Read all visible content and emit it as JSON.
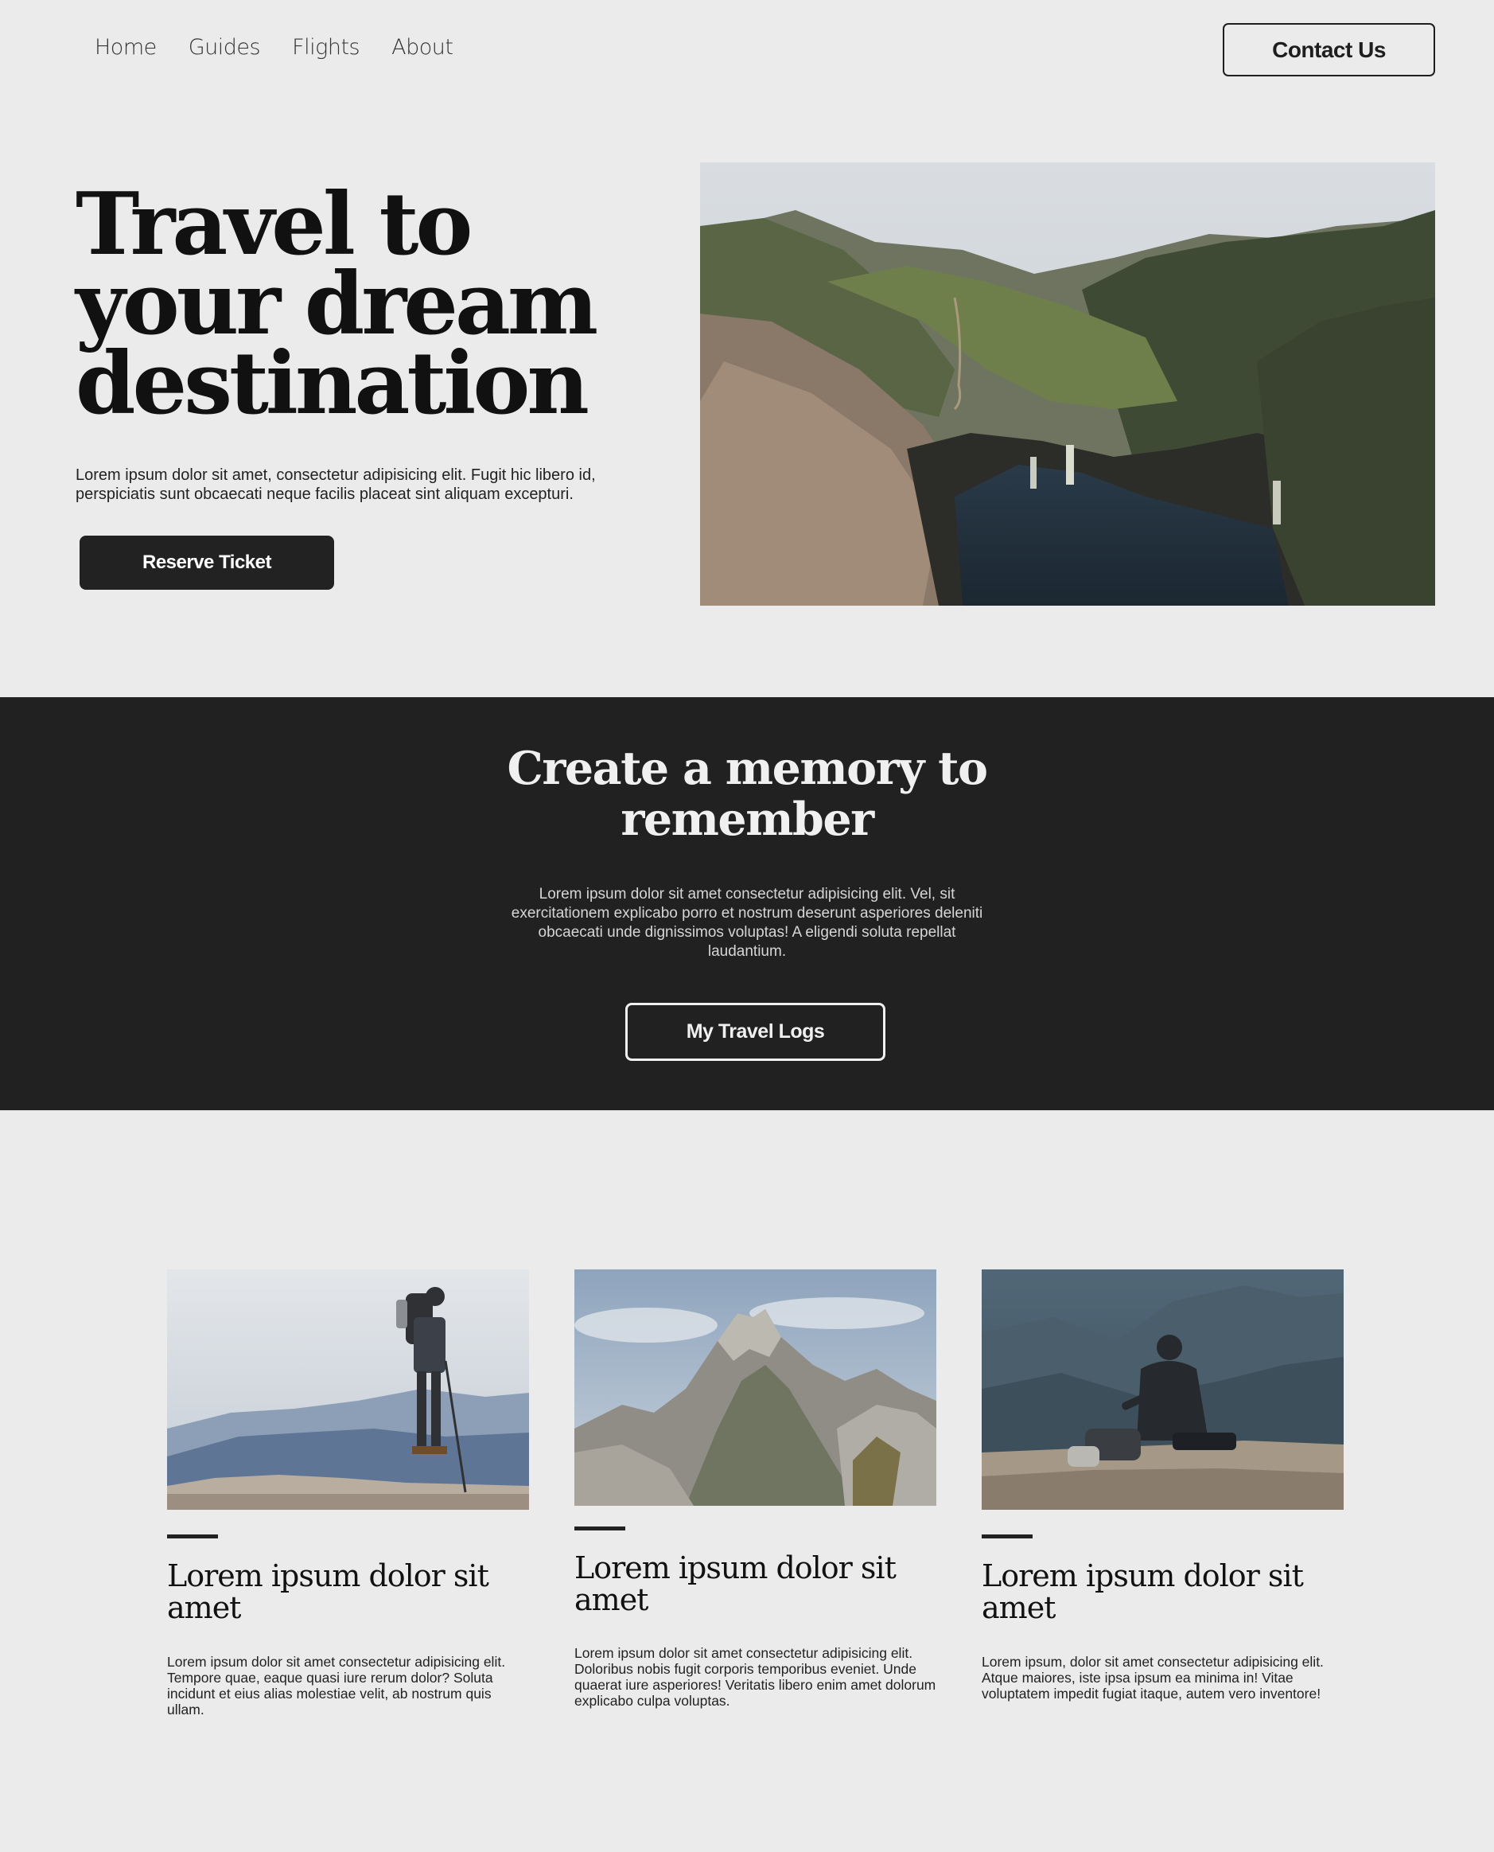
{
  "nav": {
    "links": [
      "Home",
      "Guides",
      "Flights",
      "About"
    ],
    "contact_label": "Contact Us"
  },
  "hero": {
    "title_lines": [
      "Travel to",
      "your dream",
      "destination"
    ],
    "text": "Lorem ipsum dolor sit amet, consectetur adipisicing elit. Fugit hic libero id, perspiciatis sunt obcaecati neque facilis placeat sint aliquam excepturi.",
    "button_label": "Reserve Ticket"
  },
  "band": {
    "title_lines": [
      "Create a memory to",
      "remember"
    ],
    "text": "Lorem ipsum dolor sit amet consectetur adipisicing elit. Vel, sit exercitationem explicabo porro et nostrum deserunt asperiores deleniti obcaecati unde dignissimos voluptas! A eligendi soluta repellat laudantium.",
    "button_label": "My Travel Logs"
  },
  "cards": [
    {
      "title": "Lorem ipsum dolor sit amet",
      "text": "Lorem ipsum dolor sit amet consectetur adipisicing elit. Tempore quae, eaque quasi iure rerum dolor? Soluta incidunt et eius alias molestiae velit, ab nostrum quis ullam."
    },
    {
      "title": "Lorem ipsum dolor sit amet",
      "text": "Lorem ipsum dolor sit amet consectetur adipisicing elit. Doloribus nobis fugit corporis temporibus eveniet. Unde quaerat iure asperiores! Veritatis libero enim amet dolorum explicabo culpa voluptas."
    },
    {
      "title": "Lorem ipsum dolor sit amet",
      "text": "Lorem ipsum, dolor sit amet consectetur adipisicing elit. Atque maiores, iste ipsa ipsum ea minima in! Vitae voluptatem impedit fugiat itaque, autem vero inventore!"
    }
  ],
  "colors": {
    "page_background": "#ebebeb",
    "dark_band": "#212121",
    "text_dark": "#1e1e1e",
    "text_light": "#f0f0f0"
  }
}
